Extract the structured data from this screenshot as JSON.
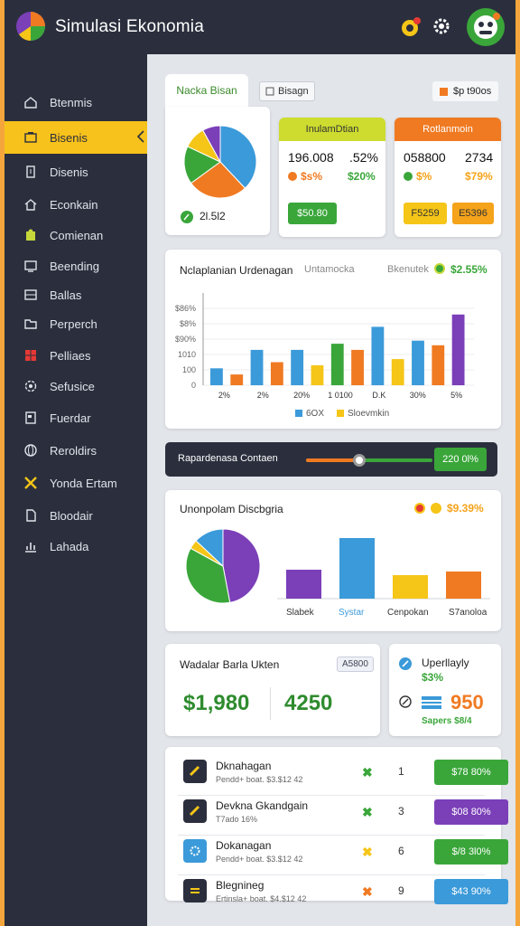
{
  "app": {
    "title": "Simulasi Ekonomia",
    "logo_icon": "pie-logo-icon",
    "header_icons": [
      "notification-icon",
      "gear-icon",
      "avatar-icon"
    ]
  },
  "colors": {
    "dark": "#2b2f3d",
    "accent_yellow": "#f7c21b",
    "green": "#3aa63a",
    "blue": "#3b9ad9",
    "orange": "#f07a22",
    "purple": "#7b3fb8"
  },
  "sidebar": {
    "items": [
      {
        "label": "Btenmis",
        "icon": "home-icon"
      },
      {
        "label": "Bisenis",
        "icon": "briefcase-icon",
        "active": true
      },
      {
        "label": "Disenis",
        "icon": "building-icon"
      },
      {
        "label": "Econkain",
        "icon": "home-outline-icon"
      },
      {
        "label": "Comienan",
        "icon": "puzzle-icon"
      },
      {
        "label": "Beending",
        "icon": "monitor-icon"
      },
      {
        "label": "Ballas",
        "icon": "list-icon"
      },
      {
        "label": "Perperch",
        "icon": "folder-icon"
      },
      {
        "label": "Pelliaes",
        "icon": "grid-icon"
      },
      {
        "label": "Sefusice",
        "icon": "settings-icon"
      },
      {
        "label": "Fuerdar",
        "icon": "document-icon"
      },
      {
        "label": "Reroldirs",
        "icon": "globe-icon"
      },
      {
        "label": "Yonda Ertam",
        "icon": "tools-icon"
      },
      {
        "label": "Bloodair",
        "icon": "file-icon"
      },
      {
        "label": "Lahada",
        "icon": "chart-icon"
      }
    ]
  },
  "tabs": {
    "active": "Nacka Bisan",
    "secondary": "Bisagn",
    "badge": "$p t90os"
  },
  "summary": {
    "pie_value": "2l.5l2",
    "card1": {
      "header": "InulamDtian",
      "v1": "196.008",
      "v2": ".52%",
      "s1": "$s%",
      "s2": "$20%",
      "button": "$50.80"
    },
    "card2": {
      "header": "Rotlanmoin",
      "v1": "058800",
      "v2": "2734",
      "s1": "$%",
      "s2": "$79%",
      "btn1": "F5259",
      "btn2": "E5396"
    }
  },
  "chart1": {
    "title": "Nclaplanian Urdenagan",
    "subtitle": "Untamocka",
    "right_label": "Bkenutek",
    "right_value": "$2.55%",
    "legend": [
      "6OX",
      "Sloevmkin"
    ]
  },
  "chart_data": [
    {
      "type": "bar",
      "title": "Nclaplanian Urdenagan",
      "y_tick_labels": [
        "0",
        "100",
        "1010",
        "$90%",
        "$8%",
        "$86%"
      ],
      "x_tick_labels": [
        "2%",
        "2%",
        "20%",
        "1 0100",
        "D.K",
        "30%",
        "5%"
      ],
      "ylim": [
        0,
        6
      ],
      "values": [
        1.1,
        0.7,
        2.3,
        1.5,
        2.3,
        1.3,
        2.7,
        2.3,
        3.8,
        1.7,
        2.9,
        2.6,
        4.6
      ],
      "colors": [
        "#3b9ad9",
        "#f07a22",
        "#3b9ad9",
        "#f07a22",
        "#3b9ad9",
        "#f5c518",
        "#3aa63a",
        "#f07a22",
        "#3b9ad9",
        "#f5c518",
        "#3b9ad9",
        "#f07a22",
        "#7b3fb8"
      ],
      "grid": true
    },
    {
      "type": "pie",
      "slices": [
        {
          "value": 38,
          "color": "#3b9ad9"
        },
        {
          "value": 27,
          "color": "#f07a22"
        },
        {
          "value": 17,
          "color": "#3aa63a"
        },
        {
          "value": 10,
          "color": "#f5c518"
        },
        {
          "value": 8,
          "color": "#7b3fb8"
        }
      ]
    },
    {
      "type": "pie",
      "slices": [
        {
          "value": 47,
          "color": "#7b3fb8"
        },
        {
          "value": 36,
          "color": "#3aa63a"
        },
        {
          "value": 4,
          "color": "#f5c518"
        },
        {
          "value": 13,
          "color": "#3b9ad9"
        }
      ]
    },
    {
      "type": "bar",
      "categories": [
        "Slabek",
        "Systar",
        "Cenpokan",
        "S7anoloa"
      ],
      "values": [
        32,
        67,
        26,
        30
      ],
      "colors": [
        "#7b3fb8",
        "#3b9ad9",
        "#f5c518",
        "#f07a22"
      ],
      "ylim": [
        0,
        70
      ]
    }
  ],
  "slider": {
    "label": "Rapardenasa Contaen",
    "value": "220 0l%",
    "level": 0.42
  },
  "chart2": {
    "title": "Unonpolam Discbgria",
    "value": "$9.39%",
    "categories": [
      "Slabek",
      "Systar",
      "Cenpokan",
      "S7anoloa"
    ]
  },
  "totals": {
    "title": "Wadalar Barla Ukten",
    "badge": "A5800",
    "v1": "$1,980",
    "v2": "4250"
  },
  "update": {
    "title": "Uperllayly",
    "sub": "$3%",
    "value": "950",
    "footer": "Sapers $8/4"
  },
  "rows": [
    {
      "name": "Dknahagan",
      "sub": "Pendd+ boat. $3.$12 42",
      "mark": "✖",
      "mark_color": "#3aa63a",
      "num": "1",
      "btn": "$78 80%",
      "btn_color": "#3aa63a",
      "icon": "tag-icon"
    },
    {
      "name": "Devkna Gkandgain",
      "sub": "T7ado 16%",
      "mark": "✖",
      "mark_color": "#3aa63a",
      "num": "3",
      "btn": "$08 80%",
      "btn_color": "#7b3fb8",
      "icon": "tag-icon"
    },
    {
      "name": "Dokanagan",
      "sub": "Pendd+ boat. $3.$12 42",
      "mark": "✖",
      "mark_color": "#f5c518",
      "num": "6",
      "btn": "$/8 3l0%",
      "btn_color": "#3aa63a",
      "icon": "gear-icon"
    },
    {
      "name": "Blegnineg",
      "sub": "Ertinsla+ boat. $4.$12 42",
      "mark": "✖",
      "mark_color": "#f07a22",
      "num": "9",
      "btn": "$43 90%",
      "btn_color": "#3b9ad9",
      "icon": "list-icon"
    }
  ]
}
